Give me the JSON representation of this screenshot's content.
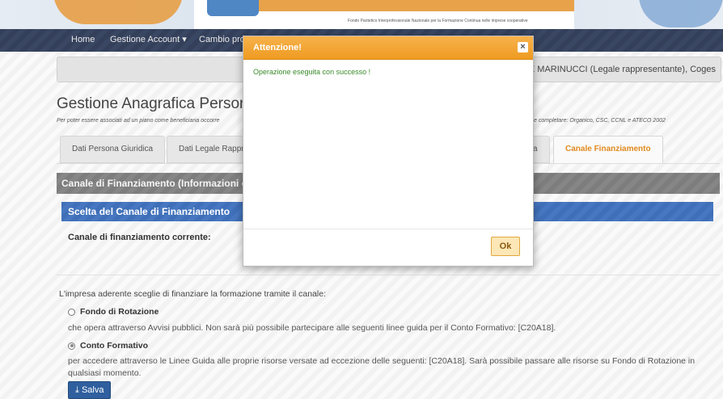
{
  "banner": {
    "tagline": "Fondo Paritetico Interprofessionale Nazionale per la Formazione Continua nelle imprese cooperative"
  },
  "nav": {
    "items": [
      "Home",
      "Gestione Account ▾",
      "Cambio pro"
    ]
  },
  "userbar": {
    "text": "SE MARINUCCI (Legale rappresentante), Coges"
  },
  "page": {
    "title": "Gestione Anagrafica Persona",
    "note_left": "Per poter essere associati ad un piano come beneficiaria occorre",
    "note_right": "e completare: Organico, CSC, CCNL e ATECO 2002"
  },
  "tabs": [
    {
      "label": "Dati Persona Giuridica"
    },
    {
      "label": "Dati Legale Rappr"
    },
    {
      "label": "a"
    },
    {
      "label": "Canale Finanziamento"
    }
  ],
  "section": {
    "head": "Canale di Finanziamento (Informazioni o",
    "subhead": "Scelta del Canale di Finanziamento",
    "current_label": "Canale di finanziamento corrente:"
  },
  "choice": {
    "intro": "L'impresa aderente sceglie di finanziare la formazione tramite il canale:",
    "option1_label": "Fondo di Rotazione",
    "option1_desc": "che opera attraverso Avvisi pubblici. Non sarà più possibile partecipare alle seguenti linee guida per il Conto Formativo: [C20A18].",
    "option2_label": "Conto Formativo",
    "option2_desc": "per accedere attraverso le Linee Guida alle proprie risorse versate ad eccezione delle seguenti: [C20A18]. Sarà possibile passare alle risorse su Fondo di Rotazione in qualsiasi momento.",
    "selected": "Conto Formativo",
    "save_label": "Salva",
    "save_icon": "download-icon"
  },
  "modal": {
    "title": "Attenzione!",
    "message": "Operazione eseguita con successo !",
    "ok_label": "Ok",
    "close_icon": "close-icon"
  },
  "colors": {
    "accent_orange": "#ef9b22",
    "nav_bg": "#34405a",
    "subhead_blue": "#3f6fb8",
    "success_green": "#3a8a2a"
  }
}
